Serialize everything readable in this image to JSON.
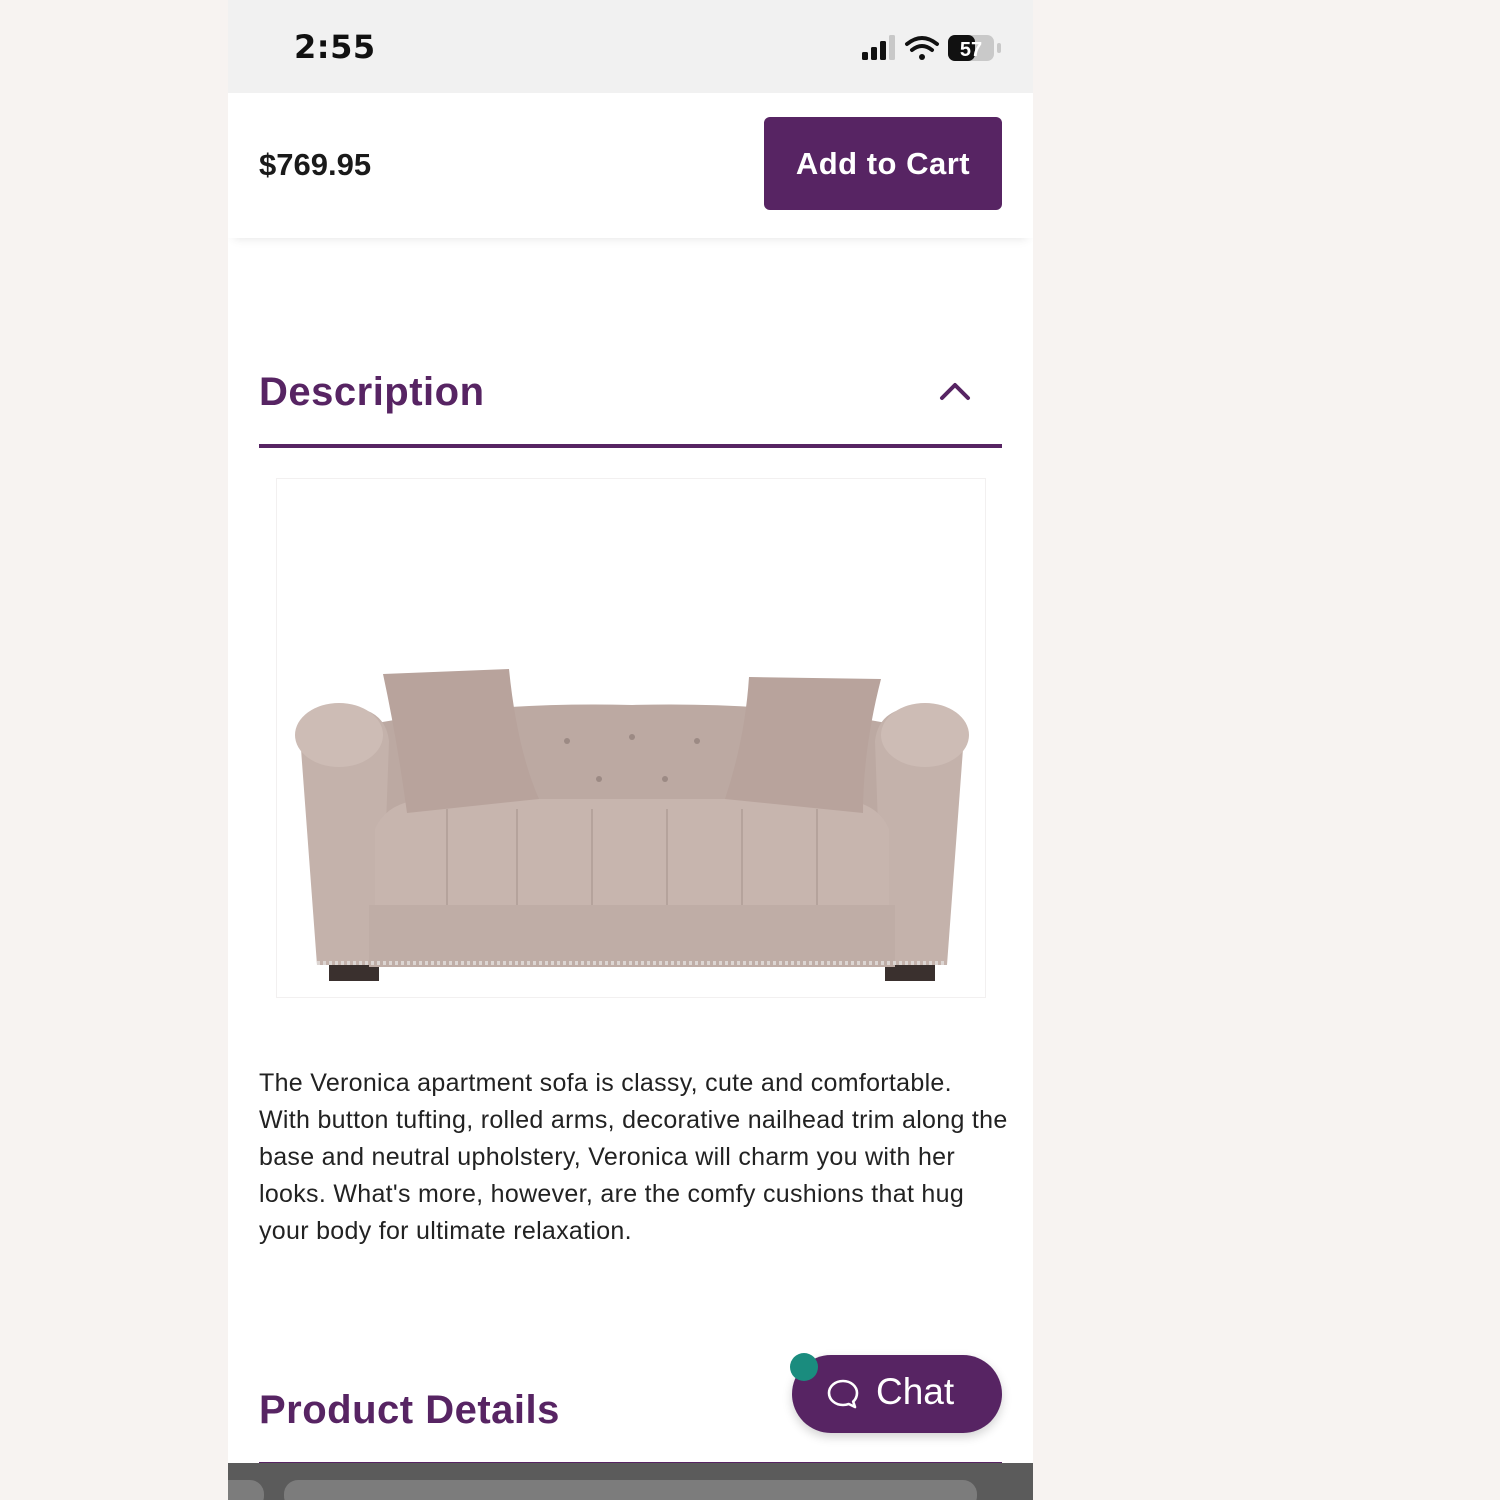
{
  "status_bar": {
    "time": "2:55",
    "battery_level": "57"
  },
  "purchase_bar": {
    "price": "$769.95",
    "add_to_cart_label": "Add to Cart"
  },
  "description_section": {
    "title": "Description",
    "expanded": true,
    "text": "The Veronica apartment sofa is classy, cute and comfortable. With button tufting, rolled arms, decorative nailhead trim along the base and neutral upholstery, Veronica will charm you with her looks. What's more, however, are the comfy cushions that hug your body for ultimate relaxation."
  },
  "product_details_section": {
    "title": "Product Details"
  },
  "chat": {
    "label": "Chat"
  },
  "colors": {
    "brand_purple": "#572463",
    "online_dot": "#1a8c7e"
  },
  "icons": [
    "signal-icon",
    "wifi-icon",
    "battery-icon",
    "chevron-up-icon",
    "chat-bubble-icon"
  ]
}
